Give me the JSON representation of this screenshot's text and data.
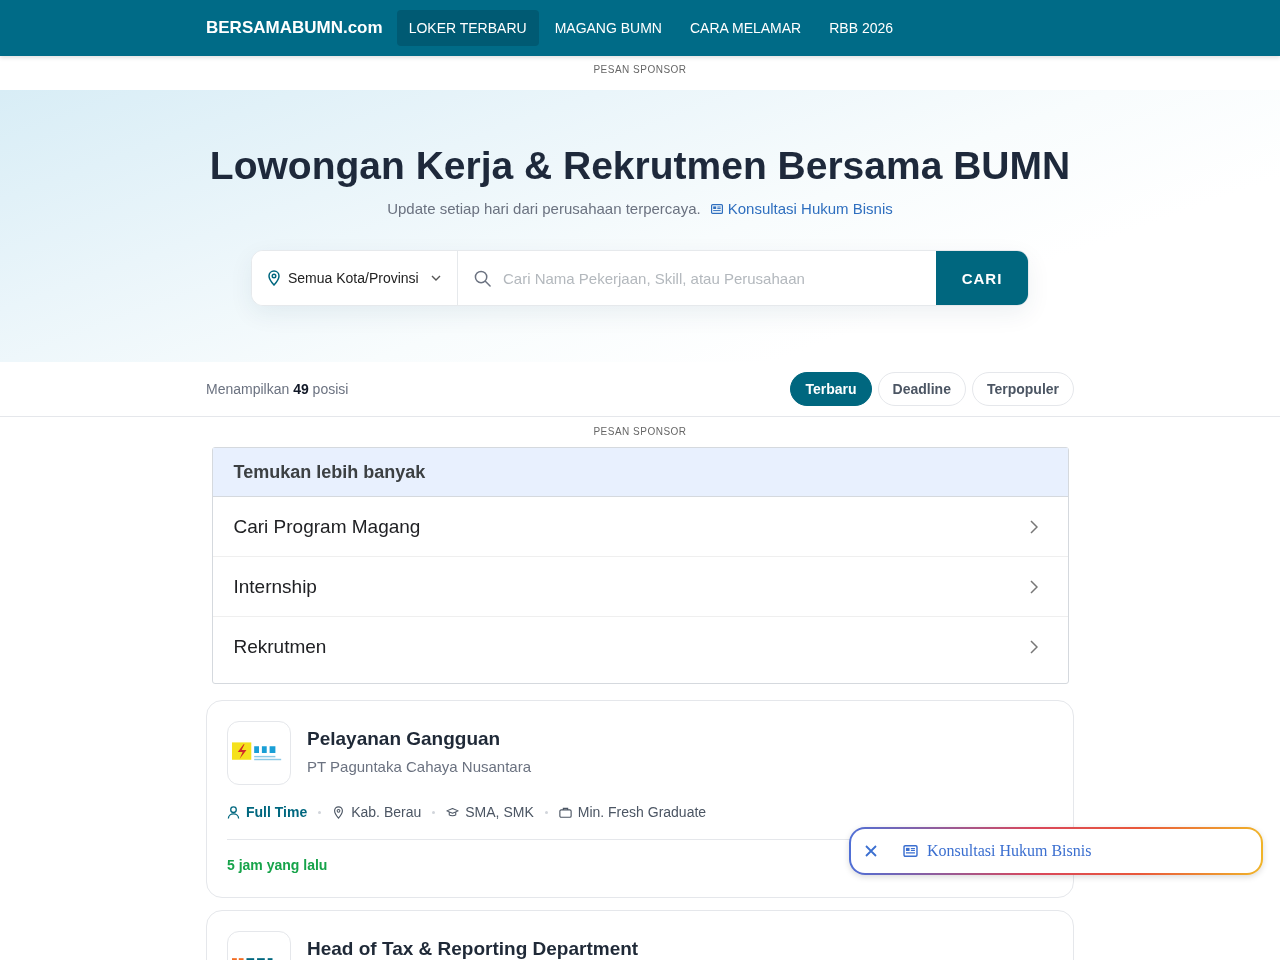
{
  "header": {
    "logo": "BERSAMABUMN.com",
    "nav": [
      {
        "label": "LOKER TERBARU",
        "selected": true
      },
      {
        "label": "MAGANG BUMN",
        "selected": false
      },
      {
        "label": "CARA MELAMAR",
        "selected": false
      },
      {
        "label": "RBB 2026",
        "selected": false
      }
    ]
  },
  "sponsor_top": {
    "label": "PESAN SPONSOR"
  },
  "hero": {
    "title": "Lowongan Kerja & Rekrutmen Bersama BUMN",
    "subtitle": "Update setiap hari dari perusahaan terpercaya.",
    "link": "Konsultasi Hukum Bisnis"
  },
  "search": {
    "location": "Semua Kota/Provinsi",
    "placeholder": "Cari Nama Pekerjaan, Skill, atau Perusahaan",
    "button": "CARI"
  },
  "results": {
    "summary": "Menampilkan **49** posisi",
    "sort": [
      {
        "label": "Terbaru",
        "selected": true
      },
      {
        "label": "Deadline",
        "selected": false
      },
      {
        "label": "Terpopuler",
        "selected": false
      }
    ]
  },
  "sponsor_mid": {
    "label": "PESAN SPONSOR"
  },
  "ad": {
    "title": "Temukan lebih banyak",
    "items": [
      "Cari Program Magang",
      "Internship",
      "Rekrutmen"
    ]
  },
  "jobs": [
    {
      "kind": "bolt",
      "title": "Pelayanan Gangguan",
      "company": "PT Paguntaka Cahaya Nusantara",
      "meta": [
        {
          "kind": "type",
          "text": "Full Time"
        },
        {
          "kind": "location",
          "text": "Kab. Berau"
        },
        {
          "kind": "education",
          "text": "SMA, SMK"
        },
        {
          "kind": "experience",
          "text": "Min. Fresh Graduate"
        }
      ],
      "posted": "5 jam yang lalu"
    },
    {
      "kind": "bars",
      "title": "Head of Tax & Reporting Department"
    }
  ],
  "floating_banner": {
    "link": "Konsultasi Hukum Bisnis"
  }
}
